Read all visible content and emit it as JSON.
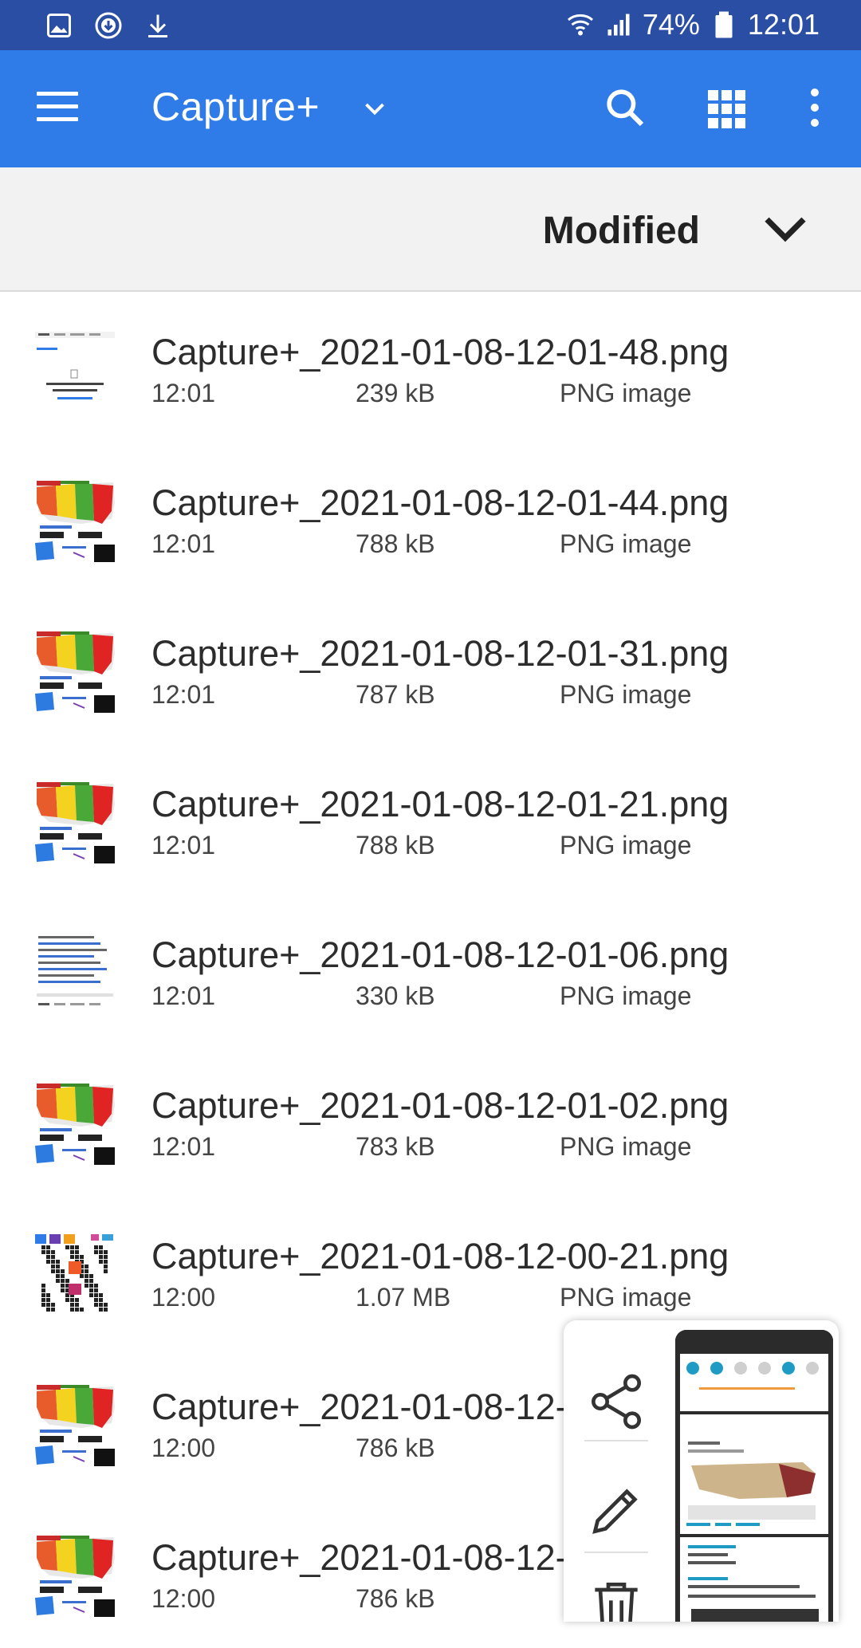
{
  "status_bar": {
    "battery": "74%",
    "time": "12:01",
    "left_icons": [
      "image-icon",
      "download-circle-icon",
      "download-icon"
    ],
    "right_icons": [
      "wifi-icon",
      "signal-icon",
      "battery-icon"
    ]
  },
  "app_bar": {
    "title": "Capture+",
    "icons": [
      "menu-icon",
      "chevron-down-icon",
      "search-icon",
      "grid-view-icon",
      "more-vert-icon"
    ],
    "color": "#2f7be8"
  },
  "sort": {
    "label": "Modified"
  },
  "files": [
    {
      "name": "Capture+_2021-01-08-12-01-48.png",
      "time": "12:01",
      "size": "239 kB",
      "type": "PNG image",
      "thumb": "doc"
    },
    {
      "name": "Capture+_2021-01-08-12-01-44.png",
      "time": "12:01",
      "size": "788 kB",
      "type": "PNG image",
      "thumb": "map"
    },
    {
      "name": "Capture+_2021-01-08-12-01-31.png",
      "time": "12:01",
      "size": "787 kB",
      "type": "PNG image",
      "thumb": "map"
    },
    {
      "name": "Capture+_2021-01-08-12-01-21.png",
      "time": "12:01",
      "size": "788 kB",
      "type": "PNG image",
      "thumb": "map"
    },
    {
      "name": "Capture+_2021-01-08-12-01-06.png",
      "time": "12:01",
      "size": "330 kB",
      "type": "PNG image",
      "thumb": "text"
    },
    {
      "name": "Capture+_2021-01-08-12-01-02.png",
      "time": "12:01",
      "size": "783 kB",
      "type": "PNG image",
      "thumb": "map"
    },
    {
      "name": "Capture+_2021-01-08-12-00-21.png",
      "time": "12:00",
      "size": "1.07 MB",
      "type": "PNG image",
      "thumb": "qr"
    },
    {
      "name": "Capture+_2021-01-08-12-",
      "time": "12:00",
      "size": "786 kB",
      "type": "",
      "thumb": "map"
    },
    {
      "name": "Capture+_2021-01-08-12-",
      "time": "12:00",
      "size": "786 kB",
      "type": "",
      "thumb": "map"
    }
  ],
  "screenshot_panel": {
    "actions": [
      "share-icon",
      "edit-icon",
      "delete-icon"
    ]
  }
}
